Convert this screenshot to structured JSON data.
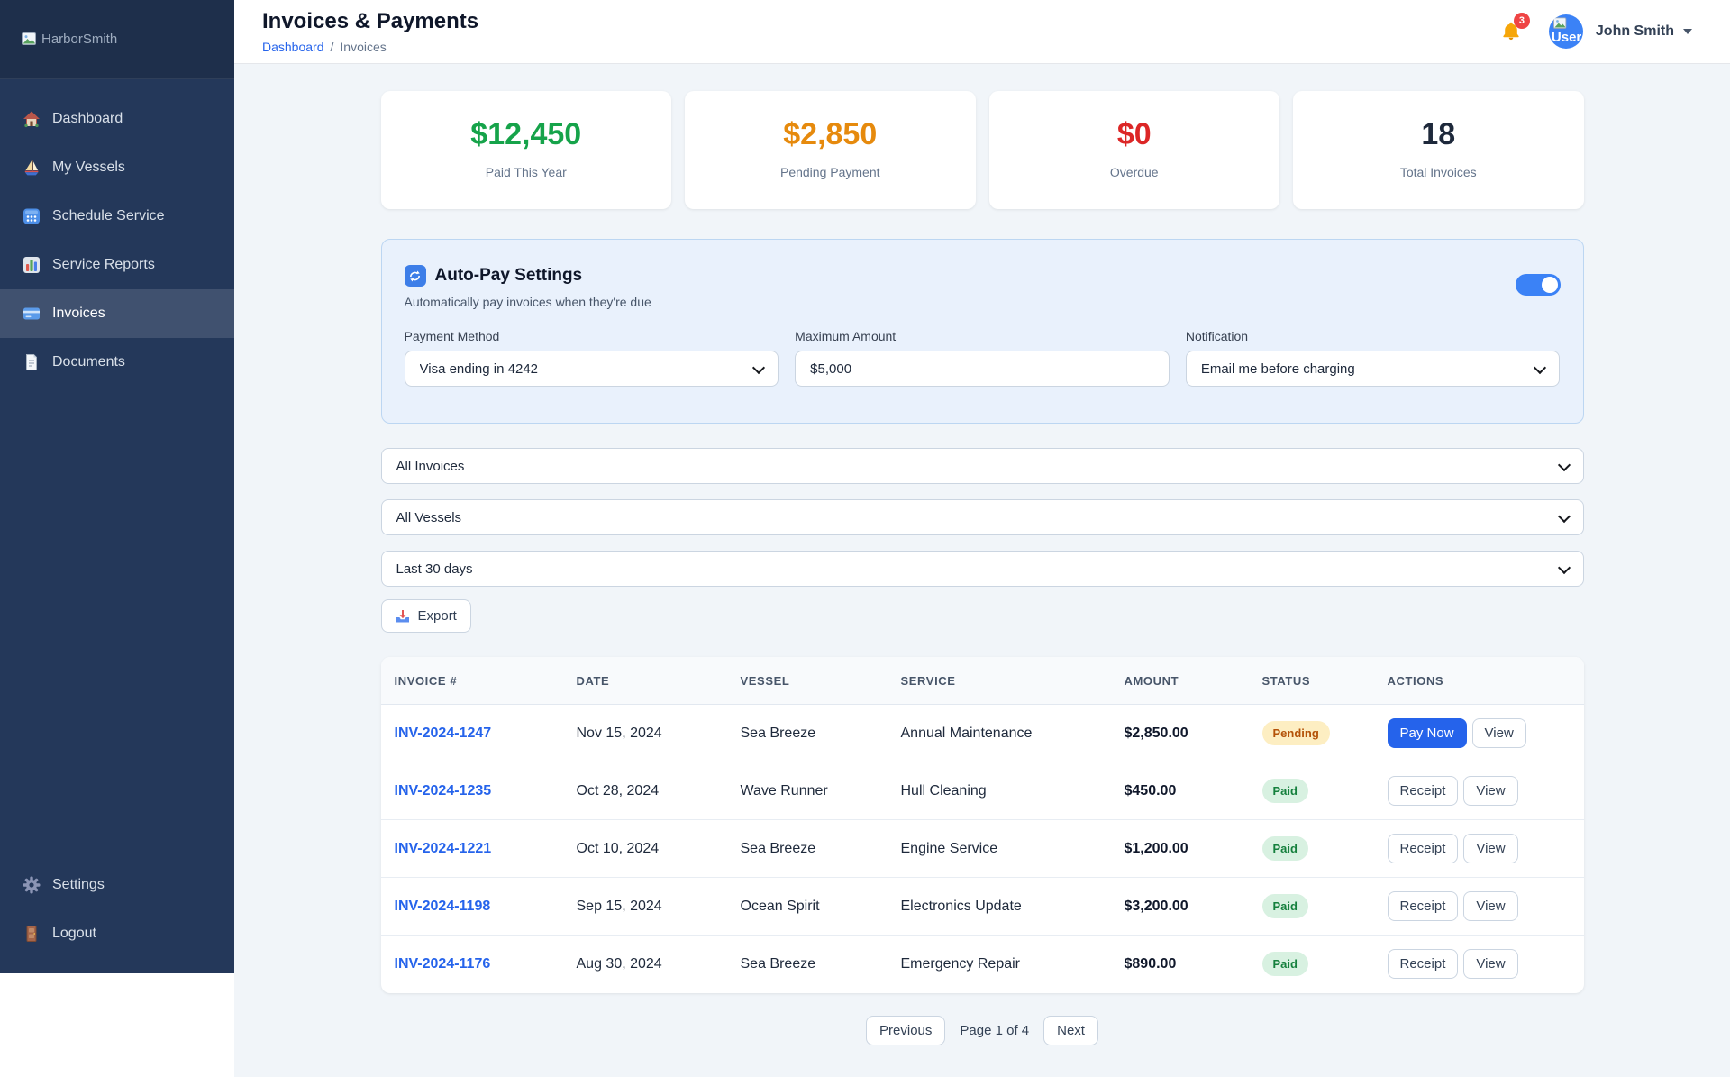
{
  "brand": {
    "name": "HarborSmith"
  },
  "sidebar": {
    "items": [
      {
        "icon": "home-icon",
        "label": "Dashboard",
        "active": false
      },
      {
        "icon": "sailboat-icon",
        "label": "My Vessels",
        "active": false
      },
      {
        "icon": "calendar-icon",
        "label": "Schedule Service",
        "active": false
      },
      {
        "icon": "bar-chart-icon",
        "label": "Service Reports",
        "active": false
      },
      {
        "icon": "credit-card-icon",
        "label": "Invoices",
        "active": true
      },
      {
        "icon": "document-icon",
        "label": "Documents",
        "active": false
      }
    ],
    "footer_items": [
      {
        "icon": "gear-icon",
        "label": "Settings"
      },
      {
        "icon": "door-icon",
        "label": "Logout"
      }
    ]
  },
  "header": {
    "title": "Invoices & Payments",
    "breadcrumb": {
      "link": "Dashboard",
      "separator": "/",
      "current": "Invoices"
    },
    "notifications_count": "3",
    "user_name": "John Smith",
    "avatar_alt": "User"
  },
  "stats": [
    {
      "value": "$12,450",
      "label": "Paid This Year",
      "color": "#16a34a"
    },
    {
      "value": "$2,850",
      "label": "Pending Payment",
      "color": "#e68a0d"
    },
    {
      "value": "$0",
      "label": "Overdue",
      "color": "#dc2626"
    },
    {
      "value": "18",
      "label": "Total Invoices",
      "color": "#1e293b"
    }
  ],
  "autopay": {
    "title": "Auto-Pay Settings",
    "subtitle": "Automatically pay invoices when they're due",
    "enabled": true,
    "fields": [
      {
        "label": "Payment Method",
        "value": "Visa ending in 4242",
        "type": "select"
      },
      {
        "label": "Maximum Amount",
        "value": "$5,000",
        "type": "input"
      },
      {
        "label": "Notification",
        "value": "Email me before charging",
        "type": "select"
      }
    ]
  },
  "filters": {
    "invoice_filter": "All Invoices",
    "vessel_filter": "All Vessels",
    "date_filter": "Last 30 days",
    "export_label": "Export"
  },
  "table": {
    "columns": [
      "INVOICE #",
      "DATE",
      "VESSEL",
      "SERVICE",
      "AMOUNT",
      "STATUS",
      "ACTIONS"
    ],
    "rows": [
      {
        "invoice": "INV-2024-1247",
        "date": "Nov 15, 2024",
        "vessel": "Sea Breeze",
        "service": "Annual Maintenance",
        "amount": "$2,850.00",
        "status": "Pending",
        "status_style": "pending",
        "actions": [
          {
            "label": "Pay Now",
            "style": "primary"
          },
          {
            "label": "View",
            "style": "outline"
          }
        ]
      },
      {
        "invoice": "INV-2024-1235",
        "date": "Oct 28, 2024",
        "vessel": "Wave Runner",
        "service": "Hull Cleaning",
        "amount": "$450.00",
        "status": "Paid",
        "status_style": "paid",
        "actions": [
          {
            "label": "Receipt",
            "style": "outline"
          },
          {
            "label": "View",
            "style": "outline"
          }
        ]
      },
      {
        "invoice": "INV-2024-1221",
        "date": "Oct 10, 2024",
        "vessel": "Sea Breeze",
        "service": "Engine Service",
        "amount": "$1,200.00",
        "status": "Paid",
        "status_style": "paid",
        "actions": [
          {
            "label": "Receipt",
            "style": "outline"
          },
          {
            "label": "View",
            "style": "outline"
          }
        ]
      },
      {
        "invoice": "INV-2024-1198",
        "date": "Sep 15, 2024",
        "vessel": "Ocean Spirit",
        "service": "Electronics Update",
        "amount": "$3,200.00",
        "status": "Paid",
        "status_style": "paid",
        "actions": [
          {
            "label": "Receipt",
            "style": "outline"
          },
          {
            "label": "View",
            "style": "outline"
          }
        ]
      },
      {
        "invoice": "INV-2024-1176",
        "date": "Aug 30, 2024",
        "vessel": "Sea Breeze",
        "service": "Emergency Repair",
        "amount": "$890.00",
        "status": "Paid",
        "status_style": "paid",
        "actions": [
          {
            "label": "Receipt",
            "style": "outline"
          },
          {
            "label": "View",
            "style": "outline"
          }
        ]
      }
    ]
  },
  "pagination": {
    "previous": "Previous",
    "label": "Page 1 of 4",
    "next": "Next"
  }
}
